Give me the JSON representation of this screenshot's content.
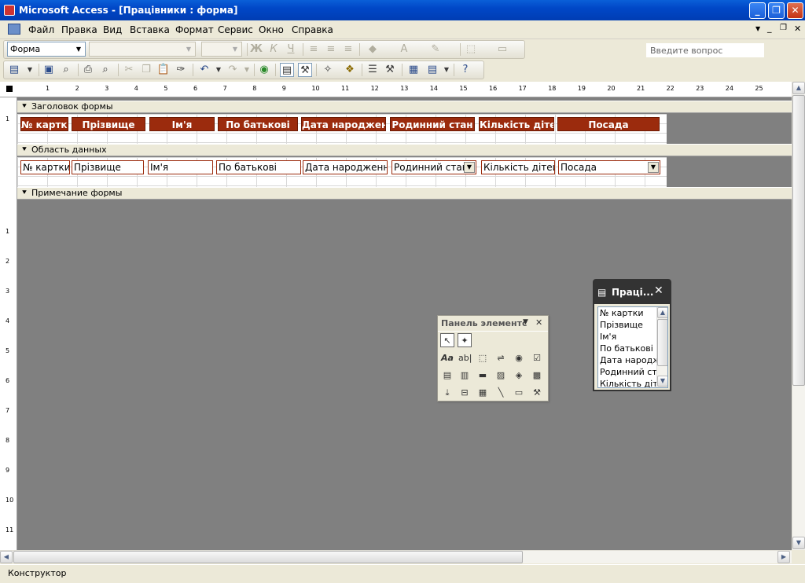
{
  "window": {
    "title": "Microsoft Access - [Працівники : форма]",
    "minimize": "_",
    "restore": "❐",
    "close": "✕"
  },
  "menu": {
    "items": [
      "Файл",
      "Правка",
      "Вид",
      "Вставка",
      "Формат",
      "Сервис",
      "Окно",
      "Справка"
    ],
    "ask_placeholder": "Введите вопрос",
    "doc_minimize": "_",
    "doc_restore": "❐",
    "doc_close": "✕"
  },
  "format_toolbar": {
    "object_combo": "Форма",
    "font_combo": "",
    "size_combo": ""
  },
  "icons": {
    "bold": "Ж",
    "italic": "К",
    "underline": "Ч",
    "font_color": "A"
  },
  "sections": {
    "header": "Заголовок формы",
    "detail": "Область данных",
    "footer": "Примечание формы"
  },
  "header_labels": [
    "№ картки",
    "Прізвище",
    "Ім'я",
    "По батькові",
    "Дата народження",
    "Родинний стан",
    "Кількість дітей",
    "Посада"
  ],
  "detail_fields": [
    "№ картки",
    "Прізвище",
    "Ім'я",
    "По батькові",
    "Дата народження",
    "Родинний стан",
    "Кількість дітей",
    "Посада"
  ],
  "ruler": {
    "top_ticks": [
      "1",
      "2",
      "3",
      "4",
      "5",
      "6",
      "7",
      "8",
      "9",
      "10",
      "11",
      "12",
      "13",
      "14",
      "15",
      "16",
      "17",
      "18",
      "19",
      "20",
      "21",
      "22",
      "23",
      "24",
      "25"
    ],
    "left_ticks": [
      "1",
      "1",
      "2",
      "3",
      "4",
      "5",
      "6",
      "7",
      "8",
      "9",
      "10",
      "11"
    ]
  },
  "toolbox": {
    "title": "Панель элементс"
  },
  "field_list": {
    "title": "Праці...",
    "items": [
      "№ картки",
      "Прізвище",
      "Ім'я",
      "По батькові",
      "Дата народже",
      "Родинний ста",
      "Кількість діте"
    ]
  },
  "status": {
    "mode": "Конструктор"
  },
  "colors": {
    "label_bg": "#9b2b0d",
    "title_bar": "#0047c7",
    "design_bg": "#808080"
  }
}
